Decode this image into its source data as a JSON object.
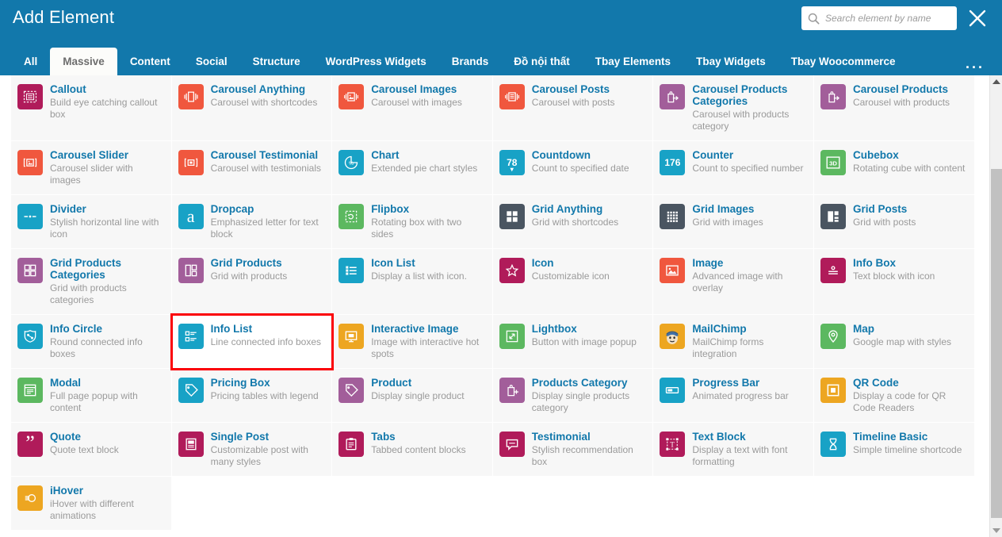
{
  "header": {
    "title": "Add Element",
    "search_placeholder": "Search element by name",
    "search_value": "",
    "close_label": "×",
    "more_label": "..."
  },
  "tabs": [
    {
      "label": "All",
      "active": false
    },
    {
      "label": "Massive",
      "active": true
    },
    {
      "label": "Content",
      "active": false
    },
    {
      "label": "Social",
      "active": false
    },
    {
      "label": "Structure",
      "active": false
    },
    {
      "label": "WordPress Widgets",
      "active": false
    },
    {
      "label": "Brands",
      "active": false
    },
    {
      "label": "Đồ nội thất",
      "active": false
    },
    {
      "label": "Tbay Elements",
      "active": false
    },
    {
      "label": "Tbay Widgets",
      "active": false
    },
    {
      "label": "Tbay Woocommerce",
      "active": false
    }
  ],
  "colors": {
    "header_blue": "#1278ab",
    "link_blue": "#1278ab",
    "selection_red": "#fb0007",
    "card_bg": "#f7f7f7",
    "icon_magenta": "#b01b5a",
    "icon_orange_red": "#f0573e",
    "icon_purple": "#a25e9a",
    "icon_cyan": "#18a2c6",
    "icon_dark_slate": "#4a5561",
    "icon_green": "#5cb860",
    "icon_amber": "#eda621"
  },
  "elements": [
    {
      "title": "Callout",
      "desc": "Build eye catching callout box",
      "icon": "callout-icon",
      "color": "#b01b5a",
      "selected": false
    },
    {
      "title": "Carousel Anything",
      "desc": "Carousel with shortcodes",
      "icon": "carousel-anything-icon",
      "color": "#f0573e",
      "selected": false
    },
    {
      "title": "Carousel Images",
      "desc": "Carousel with images",
      "icon": "carousel-images-icon",
      "color": "#f0573e",
      "selected": false
    },
    {
      "title": "Carousel Posts",
      "desc": "Carousel with posts",
      "icon": "carousel-posts-icon",
      "color": "#f0573e",
      "selected": false
    },
    {
      "title": "Carousel Products Categories",
      "desc": "Carousel with products category",
      "icon": "shopping-bag-icon",
      "color": "#a25e9a",
      "selected": false
    },
    {
      "title": "Carousel Products",
      "desc": "Carousel with products",
      "icon": "shopping-bag-icon",
      "color": "#a25e9a",
      "selected": false
    },
    {
      "title": "Carousel Slider",
      "desc": "Carousel slider with images",
      "icon": "carousel-slider-icon",
      "color": "#f0573e",
      "selected": false
    },
    {
      "title": "Carousel Testimonial",
      "desc": "Carousel with testimonials",
      "icon": "carousel-testimonial-icon",
      "color": "#f0573e",
      "selected": false
    },
    {
      "title": "Chart",
      "desc": "Extended pie chart styles",
      "icon": "pie-chart-percent-icon",
      "color": "#18a2c6",
      "selected": false
    },
    {
      "title": "Countdown",
      "desc": "Count to specified date",
      "icon": "countdown-78-icon",
      "color": "#18a2c6",
      "selected": false,
      "badge": "78"
    },
    {
      "title": "Counter",
      "desc": "Count to specified number",
      "icon": "counter-176-icon",
      "color": "#18a2c6",
      "selected": false,
      "badge": "176"
    },
    {
      "title": "Cubebox",
      "desc": "Rotating cube with content",
      "icon": "cube-3d-icon",
      "color": "#5cb860",
      "selected": false,
      "badge": "3D"
    },
    {
      "title": "Divider",
      "desc": "Stylish horizontal line with icon",
      "icon": "divider-icon",
      "color": "#18a2c6",
      "selected": false
    },
    {
      "title": "Dropcap",
      "desc": "Emphasized letter for text block",
      "icon": "dropcap-a-icon",
      "color": "#18a2c6",
      "selected": false,
      "badge": "a"
    },
    {
      "title": "Flipbox",
      "desc": "Rotating box with two sides",
      "icon": "flipbox-icon",
      "color": "#5cb860",
      "selected": false
    },
    {
      "title": "Grid Anything",
      "desc": "Grid with shortcodes",
      "icon": "grid-four-icon",
      "color": "#4a5561",
      "selected": false
    },
    {
      "title": "Grid Images",
      "desc": "Grid with images",
      "icon": "grid-dots-icon",
      "color": "#4a5561",
      "selected": false
    },
    {
      "title": "Grid Posts",
      "desc": "Grid with posts",
      "icon": "grid-posts-icon",
      "color": "#4a5561",
      "selected": false
    },
    {
      "title": "Grid Products Categories",
      "desc": "Grid with products categories",
      "icon": "grid-products-categories-icon",
      "color": "#a25e9a",
      "selected": false
    },
    {
      "title": "Grid Products",
      "desc": "Grid with products",
      "icon": "grid-products-icon",
      "color": "#a25e9a",
      "selected": false
    },
    {
      "title": "Icon List",
      "desc": "Display a list with icon.",
      "icon": "icon-list-icon",
      "color": "#18a2c6",
      "selected": false
    },
    {
      "title": "Icon",
      "desc": "Customizable icon",
      "icon": "star-icon",
      "color": "#b01b5a",
      "selected": false
    },
    {
      "title": "Image",
      "desc": "Advanced image with overlay",
      "icon": "image-icon",
      "color": "#f0573e",
      "selected": false
    },
    {
      "title": "Info Box",
      "desc": "Text block with icon",
      "icon": "info-box-icon",
      "color": "#b01b5a",
      "selected": false
    },
    {
      "title": "Info Circle",
      "desc": "Round connected info boxes",
      "icon": "info-circle-icon",
      "color": "#18a2c6",
      "selected": false
    },
    {
      "title": "Info List",
      "desc": "Line connected info boxes",
      "icon": "info-list-icon",
      "color": "#18a2c6",
      "selected": true
    },
    {
      "title": "Interactive Image",
      "desc": "Image with interactive hot spots",
      "icon": "interactive-image-icon",
      "color": "#eda621",
      "selected": false
    },
    {
      "title": "Lightbox",
      "desc": "Button with image popup",
      "icon": "expand-arrows-icon",
      "color": "#5cb860",
      "selected": false
    },
    {
      "title": "MailChimp",
      "desc": "MailChimp forms integration",
      "icon": "mailchimp-monkey-icon",
      "color": "#eda621",
      "selected": false
    },
    {
      "title": "Map",
      "desc": "Google map with styles",
      "icon": "map-pin-icon",
      "color": "#5cb860",
      "selected": false
    },
    {
      "title": "Modal",
      "desc": "Full page popup with content",
      "icon": "modal-icon",
      "color": "#5cb860",
      "selected": false
    },
    {
      "title": "Pricing Box",
      "desc": "Pricing tables with legend",
      "icon": "price-tag-icon",
      "color": "#18a2c6",
      "selected": false
    },
    {
      "title": "Product",
      "desc": "Display single product",
      "icon": "price-tag-icon",
      "color": "#a25e9a",
      "selected": false
    },
    {
      "title": "Products Category",
      "desc": "Display single products category",
      "icon": "shopping-bag-plus-icon",
      "color": "#a25e9a",
      "selected": false
    },
    {
      "title": "Progress Bar",
      "desc": "Animated progress bar",
      "icon": "progress-bar-icon",
      "color": "#18a2c6",
      "selected": false
    },
    {
      "title": "QR Code",
      "desc": "Display a code for QR Code Readers",
      "icon": "qr-code-icon",
      "color": "#eda621",
      "selected": false
    },
    {
      "title": "Quote",
      "desc": "Quote text block",
      "icon": "quote-icon",
      "color": "#b01b5a",
      "selected": false
    },
    {
      "title": "Single Post",
      "desc": "Customizable post with many styles",
      "icon": "single-post-icon",
      "color": "#b01b5a",
      "selected": false
    },
    {
      "title": "Tabs",
      "desc": "Tabbed content blocks",
      "icon": "tabs-clipboard-icon",
      "color": "#b01b5a",
      "selected": false
    },
    {
      "title": "Testimonial",
      "desc": "Stylish recommendation box",
      "icon": "speech-bubble-icon",
      "color": "#b01b5a",
      "selected": false
    },
    {
      "title": "Text Block",
      "desc": "Display a text with font formatting",
      "icon": "text-block-icon",
      "color": "#b01b5a",
      "selected": false
    },
    {
      "title": "Timeline Basic",
      "desc": "Simple timeline shortcode",
      "icon": "hourglass-icon",
      "color": "#18a2c6",
      "selected": false
    },
    {
      "title": "iHover",
      "desc": "iHover with different animations",
      "icon": "ihover-icon",
      "color": "#eda621",
      "selected": false
    }
  ]
}
